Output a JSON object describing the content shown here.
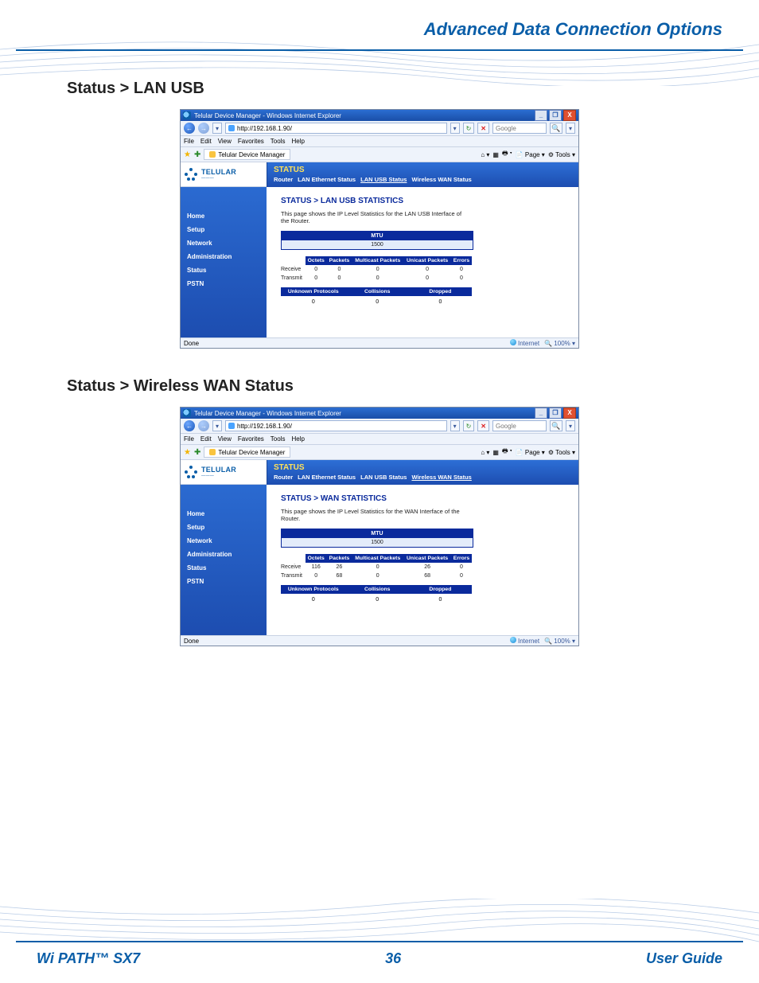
{
  "page_header": "Advanced Data Connection Options",
  "sections": [
    {
      "heading": "Status > LAN USB"
    },
    {
      "heading": "Status > Wireless WAN Status"
    }
  ],
  "footer": {
    "product": "Wi PATH™ SX7",
    "page_number": "36",
    "doc_label": "User Guide"
  },
  "browser": {
    "window_title": "Telular Device Manager - Windows Internet Explorer",
    "win_min": "_",
    "win_max": "❐",
    "win_close": "X",
    "nav_back": "←",
    "nav_fwd": "→",
    "url": "http://192.168.1.90/",
    "url_dd": "▾",
    "refresh": "↻",
    "stop": "✕",
    "search_placeholder": "Google",
    "go_icon": "🔍",
    "go_dd": "▾",
    "menus": [
      "File",
      "Edit",
      "View",
      "Favorites",
      "Tools",
      "Help"
    ],
    "fav_star": "★",
    "fav_add": "✚",
    "tab_title": "Telular Device Manager",
    "cmdbar": {
      "home": "⌂ ▾",
      "feeds": "▦",
      "print": "🖶 ▾",
      "page": "📄 Page ▾",
      "tools": "⚙ Tools ▾"
    },
    "status_done": "Done",
    "status_zone": "Internet",
    "status_zoom": "🔍 100%  ▾"
  },
  "router": {
    "brand": "TELULAR",
    "brand_sub": "———",
    "sidebar": [
      "Home",
      "Setup",
      "Network",
      "Administration",
      "Status",
      "PSTN"
    ],
    "band_title": "STATUS",
    "tabs": [
      "Router",
      "LAN Ethernet Status",
      "LAN USB Status",
      "Wireless WAN Status"
    ]
  },
  "lan_usb": {
    "title": "STATUS > LAN USB STATISTICS",
    "desc": "This page shows the IP Level Statistics for the LAN USB Interface of the Router.",
    "mtu_label": "MTU",
    "mtu_value": "1500",
    "cols": [
      "Octets",
      "Packets",
      "Multicast Packets",
      "Unicast Packets",
      "Errors"
    ],
    "rows": [
      {
        "label": "Receive",
        "vals": [
          "0",
          "0",
          "0",
          "0",
          "0"
        ]
      },
      {
        "label": "Transmit",
        "vals": [
          "0",
          "0",
          "0",
          "0",
          "0"
        ]
      }
    ],
    "cols2": [
      "Unknown Protocols",
      "Collisions",
      "Dropped"
    ],
    "row2": [
      "0",
      "0",
      "0"
    ]
  },
  "wan": {
    "title": "STATUS > WAN STATISTICS",
    "desc": "This page shows the IP Level Statistics for the WAN Interface of the Router.",
    "mtu_label": "MTU",
    "mtu_value": "1500",
    "cols": [
      "Octets",
      "Packets",
      "Multicast Packets",
      "Unicast Packets",
      "Errors"
    ],
    "rows": [
      {
        "label": "Receive",
        "vals": [
          "116",
          "26",
          "0",
          "26",
          "0"
        ]
      },
      {
        "label": "Transmit",
        "vals": [
          "0",
          "68",
          "0",
          "68",
          "0"
        ]
      }
    ],
    "cols2": [
      "Unknown Protocols",
      "Collisions",
      "Dropped"
    ],
    "row2": [
      "0",
      "0",
      "0"
    ]
  }
}
